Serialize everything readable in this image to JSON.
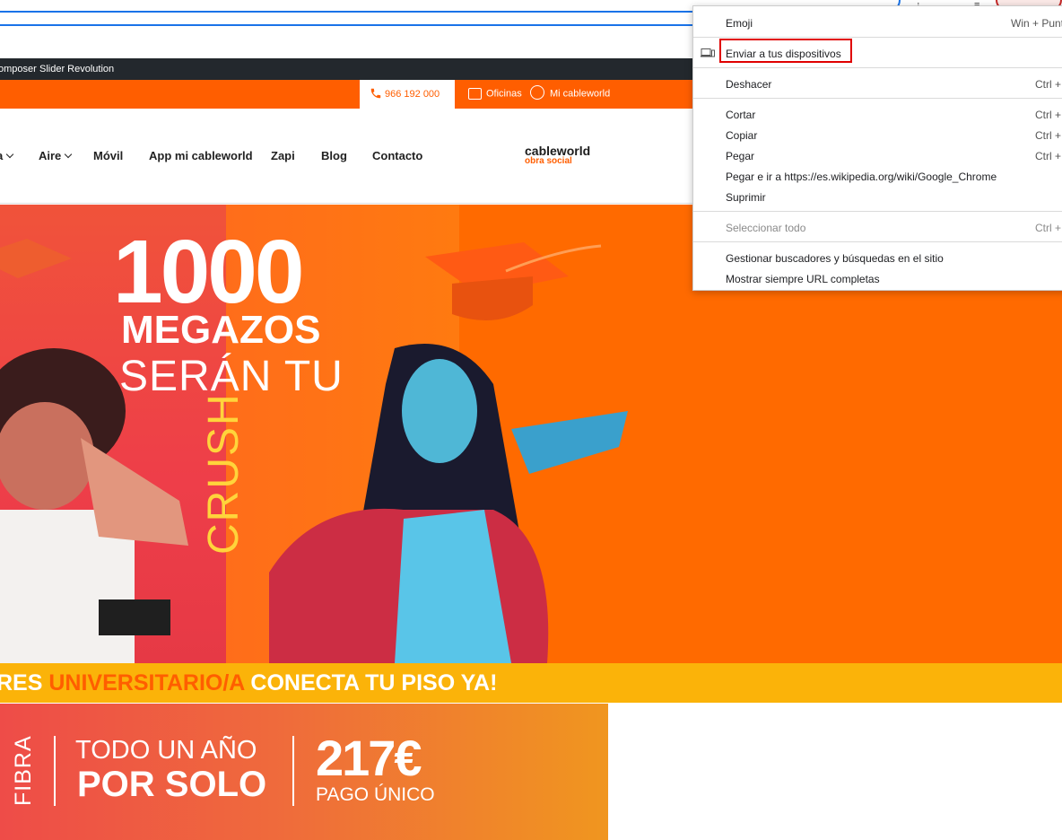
{
  "browser": {
    "omnibox_faded_text": "",
    "extension_icons": [
      "extension-icon",
      "tab-search-icon"
    ]
  },
  "admin_bar": {
    "items": [
      "omposer",
      "Slider Revolution"
    ]
  },
  "top_bar": {
    "phone": "966 192 000",
    "oficinas": "Oficinas",
    "mi_cableworld": "Mi cableworld"
  },
  "nav": {
    "items": [
      {
        "label": "a",
        "has_dropdown": true
      },
      {
        "label": "Aire",
        "has_dropdown": true
      },
      {
        "label": "Móvil",
        "has_dropdown": false
      },
      {
        "label": "App mi cableworld",
        "has_dropdown": false
      },
      {
        "label": "Zapi",
        "has_dropdown": false
      },
      {
        "label": "Blog",
        "has_dropdown": false
      },
      {
        "label": "Contacto",
        "has_dropdown": false
      }
    ],
    "logo_line1": "cableworld",
    "logo_line2": "obra social"
  },
  "hero": {
    "number": "1000",
    "line2": "MEGAZOS",
    "line3": "SERÁN TU",
    "line4": "CRUSH"
  },
  "strip": {
    "part1": "RES ",
    "part2": "UNIVERSITARIO/A",
    "part3": " CONECTA TU PISO YA!"
  },
  "promo": {
    "fibra": "FIBRA",
    "line1": "TODO UN AÑO",
    "line2": "POR SOLO",
    "price": "217€",
    "price_note": "PAGO ÚNICO"
  },
  "context_menu": {
    "items": [
      {
        "label": "Emoji",
        "shortcut": "Win + Punt",
        "disabled": false
      },
      {
        "label": "Enviar a tus dispositivos",
        "shortcut": "",
        "disabled": false
      },
      {
        "label": "Deshacer",
        "shortcut": "Ctrl +",
        "disabled": false
      },
      {
        "label": "Cortar",
        "shortcut": "Ctrl +",
        "disabled": false
      },
      {
        "label": "Copiar",
        "shortcut": "Ctrl +",
        "disabled": false
      },
      {
        "label": "Pegar",
        "shortcut": "Ctrl +",
        "disabled": false
      },
      {
        "label": "Pegar e ir a https://es.wikipedia.org/wiki/Google_Chrome",
        "shortcut": "",
        "disabled": false
      },
      {
        "label": "Suprimir",
        "shortcut": "",
        "disabled": false
      },
      {
        "label": "Seleccionar todo",
        "shortcut": "Ctrl +",
        "disabled": true
      },
      {
        "label": "Gestionar buscadores y búsquedas en el sitio",
        "shortcut": "",
        "disabled": false
      },
      {
        "label": "Mostrar siempre URL completas",
        "shortcut": "",
        "disabled": false
      }
    ]
  },
  "colors": {
    "brand_orange": "#ff5e00",
    "strip_yellow": "#fbb309",
    "crush_yellow": "#ffd43b",
    "highlight_red": "#e00000",
    "focus_blue": "#1a73e8"
  }
}
